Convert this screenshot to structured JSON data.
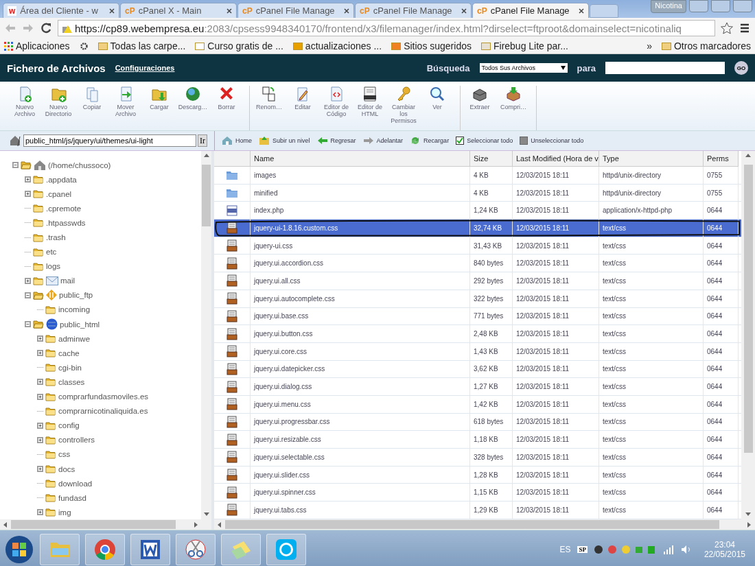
{
  "browser": {
    "tabs": [
      {
        "title": "Área del Cliente - w",
        "favicon": "w",
        "kind": "webempresa",
        "selected": false
      },
      {
        "title": "cPanel X - Main",
        "favicon": "cP",
        "kind": "cpanel",
        "selected": false
      },
      {
        "title": "cPanel File Manage",
        "favicon": "cP",
        "kind": "cpanel",
        "selected": false
      },
      {
        "title": "cPanel File Manage",
        "favicon": "cP",
        "kind": "cpanel",
        "selected": false
      },
      {
        "title": "cPanel File Manage",
        "favicon": "cP",
        "kind": "cpanel",
        "selected": true
      }
    ],
    "profile": "Nicotina",
    "url_host": "https://cp89.webempresa.eu",
    "url_rest": ":2083/cpsess9948340170/frontend/x3/filemanager/index.html?dirselect=ftproot&domainselect=nicotinaliq",
    "bookmarks": [
      "Aplicaciones",
      "Todas las carpe...",
      "Curso gratis de ...",
      "actualizaciones ...",
      "Sitios sugeridos",
      "Firebug Lite par..."
    ],
    "more": "»",
    "other_bookmarks": "Otros marcadores"
  },
  "header": {
    "title": "Fichero de Archivos",
    "settings_link": "Configuraciones",
    "search_label": "Búsqueda",
    "search_scope": "Todos Sus Archivos",
    "for_label": "para",
    "go": "GO"
  },
  "toolbar": [
    [
      {
        "label": "Nuevo Archivo",
        "kind": "newfile"
      },
      {
        "label": "Nuevo Directorio",
        "kind": "newfolder"
      },
      {
        "label": "Copiar",
        "kind": "copy"
      },
      {
        "label": "Mover Archivo",
        "kind": "move"
      },
      {
        "label": "Cargar",
        "kind": "upload"
      },
      {
        "label": "Descarg…",
        "kind": "download"
      },
      {
        "label": "Borrar",
        "kind": "delete"
      }
    ],
    [
      {
        "label": "Renom…",
        "kind": "rename"
      },
      {
        "label": "Editar",
        "kind": "edit"
      },
      {
        "label": "Editor de Código",
        "kind": "code"
      },
      {
        "label": "Editor de HTML",
        "kind": "html"
      },
      {
        "label": "Cambiar los Permisos",
        "kind": "perms"
      },
      {
        "label": "Ver",
        "kind": "view"
      }
    ],
    [
      {
        "label": "Extraer",
        "kind": "extract"
      },
      {
        "label": "Compri…",
        "kind": "compress"
      }
    ]
  ],
  "path": {
    "value": "public_html/js/jquery/ui/themes/ui-light",
    "go": "Ir"
  },
  "nav": [
    {
      "label": "Home",
      "kind": "home"
    },
    {
      "label": "Subir un nivel",
      "kind": "up"
    },
    {
      "label": "Regresar",
      "kind": "back"
    },
    {
      "label": "Adelantar",
      "kind": "forward"
    },
    {
      "label": "Recargar",
      "kind": "reload"
    },
    {
      "label": "Seleccionar todo",
      "kind": "check",
      "checked": true
    },
    {
      "label": "Unseleccionar todo",
      "kind": "check",
      "checked": false
    }
  ],
  "tree": [
    {
      "label": "(/home/chussoco)",
      "kind": "home",
      "expandable": true,
      "expanded": true,
      "children": [
        {
          "label": ".appdata",
          "kind": "folder",
          "expandable": true,
          "expanded": false
        },
        {
          "label": ".cpanel",
          "kind": "folder",
          "expandable": true,
          "expanded": false
        },
        {
          "label": ".cpremote",
          "kind": "folder",
          "expandable": false,
          "expanded": false
        },
        {
          "label": ".htpasswds",
          "kind": "folder",
          "expandable": false,
          "expanded": false
        },
        {
          "label": ".trash",
          "kind": "folder",
          "expandable": false,
          "expanded": false
        },
        {
          "label": "etc",
          "kind": "folder",
          "expandable": false,
          "expanded": false
        },
        {
          "label": "logs",
          "kind": "folder",
          "expandable": false,
          "expanded": false
        },
        {
          "label": "mail",
          "kind": "mail",
          "expandable": true,
          "expanded": false
        },
        {
          "label": "public_ftp",
          "kind": "ftp",
          "expandable": true,
          "expanded": true,
          "children": [
            {
              "label": "incoming",
              "kind": "folder",
              "expandable": false,
              "expanded": false
            }
          ]
        },
        {
          "label": "public_html",
          "kind": "web",
          "expandable": true,
          "expanded": true,
          "children": [
            {
              "label": "adminwe",
              "kind": "folder",
              "expandable": true,
              "expanded": false
            },
            {
              "label": "cache",
              "kind": "folder",
              "expandable": true,
              "expanded": false
            },
            {
              "label": "cgi-bin",
              "kind": "folder",
              "expandable": false,
              "expanded": false
            },
            {
              "label": "classes",
              "kind": "folder",
              "expandable": true,
              "expanded": false
            },
            {
              "label": "comprarfundasmoviles.es",
              "kind": "folder",
              "expandable": true,
              "expanded": false
            },
            {
              "label": "comprarnicotinaliquida.es",
              "kind": "folder",
              "expandable": false,
              "expanded": false
            },
            {
              "label": "config",
              "kind": "folder",
              "expandable": true,
              "expanded": false
            },
            {
              "label": "controllers",
              "kind": "folder",
              "expandable": true,
              "expanded": false
            },
            {
              "label": "css",
              "kind": "folder",
              "expandable": false,
              "expanded": false
            },
            {
              "label": "docs",
              "kind": "folder",
              "expandable": true,
              "expanded": false
            },
            {
              "label": "download",
              "kind": "folder",
              "expandable": false,
              "expanded": false
            },
            {
              "label": "fundasd",
              "kind": "folder",
              "expandable": false,
              "expanded": false
            },
            {
              "label": "img",
              "kind": "folder",
              "expandable": true,
              "expanded": false
            }
          ]
        }
      ]
    }
  ],
  "table": {
    "columns": [
      "Name",
      "Size",
      "Last Modified (Hora de v",
      "Type",
      "Perms"
    ],
    "rows": [
      {
        "kind": "folder",
        "name": "images",
        "size": "4 KB",
        "modified": "12/03/2015 18:11",
        "type": "httpd/unix-directory",
        "perms": "0755",
        "selected": false,
        "circled": false
      },
      {
        "kind": "folder",
        "name": "minified",
        "size": "4 KB",
        "modified": "12/03/2015 18:11",
        "type": "httpd/unix-directory",
        "perms": "0755",
        "selected": false,
        "circled": false
      },
      {
        "kind": "php",
        "name": "index.php",
        "size": "1,24 KB",
        "modified": "12/03/2015 18:11",
        "type": "application/x-httpd-php",
        "perms": "0644",
        "selected": false,
        "circled": false
      },
      {
        "kind": "css",
        "name": "jquery-ui-1.8.16.custom.css",
        "size": "32,74 KB",
        "modified": "12/03/2015 18:11",
        "type": "text/css",
        "perms": "0644",
        "selected": true,
        "circled": true
      },
      {
        "kind": "css",
        "name": "jquery-ui.css",
        "size": "31,43 KB",
        "modified": "12/03/2015 18:11",
        "type": "text/css",
        "perms": "0644",
        "selected": false,
        "circled": false
      },
      {
        "kind": "css",
        "name": "jquery.ui.accordion.css",
        "size": "840 bytes",
        "modified": "12/03/2015 18:11",
        "type": "text/css",
        "perms": "0644",
        "selected": false,
        "circled": false
      },
      {
        "kind": "css",
        "name": "jquery.ui.all.css",
        "size": "292 bytes",
        "modified": "12/03/2015 18:11",
        "type": "text/css",
        "perms": "0644",
        "selected": false,
        "circled": false
      },
      {
        "kind": "css",
        "name": "jquery.ui.autocomplete.css",
        "size": "322 bytes",
        "modified": "12/03/2015 18:11",
        "type": "text/css",
        "perms": "0644",
        "selected": false,
        "circled": false
      },
      {
        "kind": "css",
        "name": "jquery.ui.base.css",
        "size": "771 bytes",
        "modified": "12/03/2015 18:11",
        "type": "text/css",
        "perms": "0644",
        "selected": false,
        "circled": false
      },
      {
        "kind": "css",
        "name": "jquery.ui.button.css",
        "size": "2,48 KB",
        "modified": "12/03/2015 18:11",
        "type": "text/css",
        "perms": "0644",
        "selected": false,
        "circled": false
      },
      {
        "kind": "css",
        "name": "jquery.ui.core.css",
        "size": "1,43 KB",
        "modified": "12/03/2015 18:11",
        "type": "text/css",
        "perms": "0644",
        "selected": false,
        "circled": false
      },
      {
        "kind": "css",
        "name": "jquery.ui.datepicker.css",
        "size": "3,62 KB",
        "modified": "12/03/2015 18:11",
        "type": "text/css",
        "perms": "0644",
        "selected": false,
        "circled": false
      },
      {
        "kind": "css",
        "name": "jquery.ui.dialog.css",
        "size": "1,27 KB",
        "modified": "12/03/2015 18:11",
        "type": "text/css",
        "perms": "0644",
        "selected": false,
        "circled": false
      },
      {
        "kind": "css",
        "name": "jquery.ui.menu.css",
        "size": "1,42 KB",
        "modified": "12/03/2015 18:11",
        "type": "text/css",
        "perms": "0644",
        "selected": false,
        "circled": false
      },
      {
        "kind": "css",
        "name": "jquery.ui.progressbar.css",
        "size": "618 bytes",
        "modified": "12/03/2015 18:11",
        "type": "text/css",
        "perms": "0644",
        "selected": false,
        "circled": false
      },
      {
        "kind": "css",
        "name": "jquery.ui.resizable.css",
        "size": "1,18 KB",
        "modified": "12/03/2015 18:11",
        "type": "text/css",
        "perms": "0644",
        "selected": false,
        "circled": false
      },
      {
        "kind": "css",
        "name": "jquery.ui.selectable.css",
        "size": "328 bytes",
        "modified": "12/03/2015 18:11",
        "type": "text/css",
        "perms": "0644",
        "selected": false,
        "circled": false
      },
      {
        "kind": "css",
        "name": "jquery.ui.slider.css",
        "size": "1,28 KB",
        "modified": "12/03/2015 18:11",
        "type": "text/css",
        "perms": "0644",
        "selected": false,
        "circled": false
      },
      {
        "kind": "css",
        "name": "jquery.ui.spinner.css",
        "size": "1,15 KB",
        "modified": "12/03/2015 18:11",
        "type": "text/css",
        "perms": "0644",
        "selected": false,
        "circled": false
      },
      {
        "kind": "css",
        "name": "jquery.ui.tabs.css",
        "size": "1,29 KB",
        "modified": "12/03/2015 18:11",
        "type": "text/css",
        "perms": "0644",
        "selected": false,
        "circled": false
      }
    ]
  },
  "taskbar": {
    "apps": [
      {
        "kind": "explorer"
      },
      {
        "kind": "chrome"
      },
      {
        "kind": "word"
      },
      {
        "kind": "scissors"
      },
      {
        "kind": "notes"
      },
      {
        "kind": "skype"
      }
    ],
    "language": "ES",
    "ime": "SP",
    "time": "23:04",
    "date": "22/05/2015"
  }
}
